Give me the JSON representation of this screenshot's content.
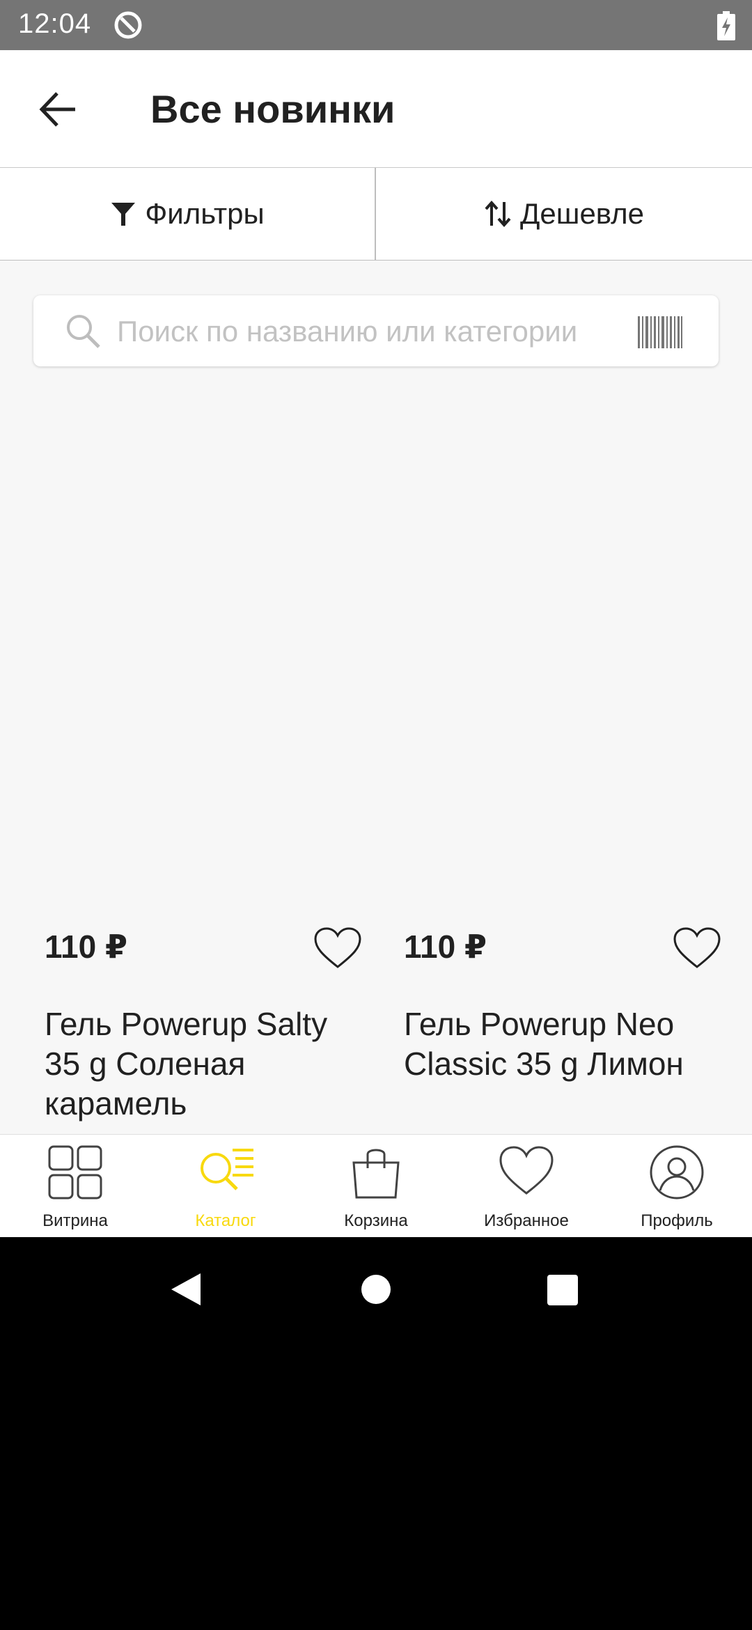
{
  "status_bar": {
    "time": "12:04"
  },
  "header": {
    "title": "Все новинки"
  },
  "toolbar": {
    "filters_label": "Фильтры",
    "sort_label": "Дешевле"
  },
  "search": {
    "placeholder": "Поиск по названию или категории"
  },
  "products": [
    {
      "price": "110 ₽",
      "name": "Гель Powerup Salty 35 g Соленая карамель"
    },
    {
      "price": "110 ₽",
      "name": "Гель Powerup Neo Classic 35 g Лимон"
    }
  ],
  "bottom_nav": {
    "items": [
      {
        "label": "Витрина",
        "icon": "grid-icon"
      },
      {
        "label": "Каталог",
        "icon": "catalog-search-icon"
      },
      {
        "label": "Корзина",
        "icon": "bag-icon"
      },
      {
        "label": "Избранное",
        "icon": "heart-icon"
      },
      {
        "label": "Профиль",
        "icon": "profile-icon"
      }
    ],
    "active_index": 1
  },
  "colors": {
    "accent": "#f8d90f",
    "status_bar": "#757575",
    "background": "#f7f7f7"
  }
}
